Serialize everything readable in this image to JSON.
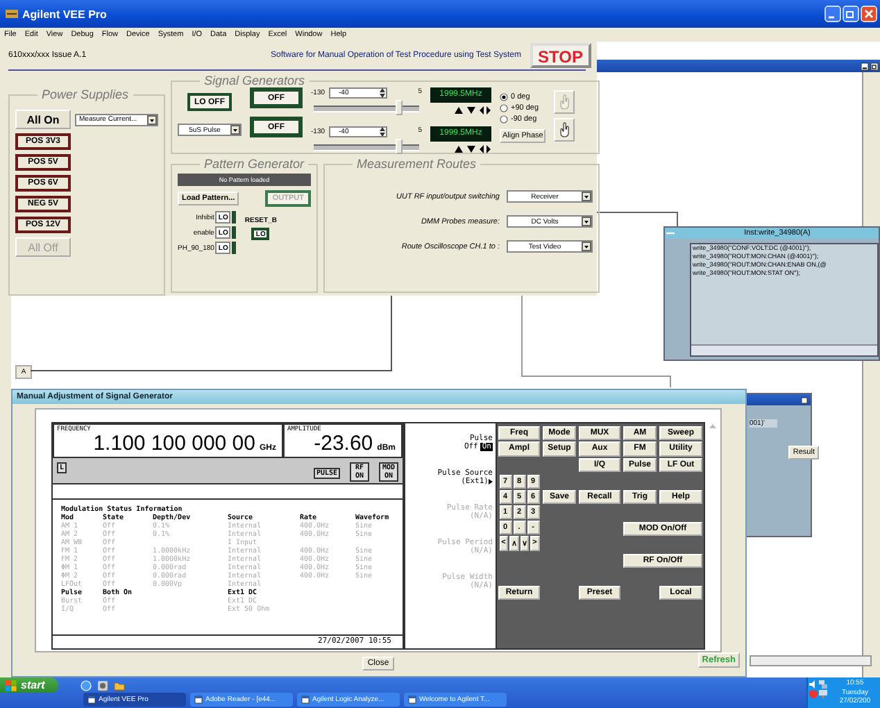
{
  "app": {
    "title": "Agilent VEE Pro",
    "menu": [
      "File",
      "Edit",
      "View",
      "Debug",
      "Flow",
      "Device",
      "System",
      "I/O",
      "Data",
      "Display",
      "Excel",
      "Window",
      "Help"
    ]
  },
  "panel": {
    "issue": "610xxx/xxx Issue A.1",
    "heading": "Software for Manual Operation of Test Procedure using Test System",
    "stop": "STOP",
    "power_supplies": {
      "title": "Power Supplies",
      "all_on": "All On",
      "measure": "Measure Current...",
      "rails": [
        "POS 3V3",
        "POS 5V",
        "POS 6V",
        "NEG 5V",
        "POS 12V"
      ],
      "all_off": {
        "label": "All Off",
        "disabled": true
      }
    },
    "signal_generators": {
      "title": "Signal Generators",
      "lo_off": "LO OFF",
      "pulse_mode": "5uS Pulse",
      "channels": [
        {
          "output": "OFF",
          "min": "-130",
          "value": "-40",
          "max": "5",
          "level": 0.8,
          "frequency": "1999.5MHz"
        },
        {
          "output": "OFF",
          "min": "-130",
          "value": "-40",
          "max": "5",
          "level": 0.8,
          "frequency": "1999.5MHz"
        }
      ],
      "phases": [
        {
          "label": "0 deg",
          "selected": true
        },
        {
          "label": "+90 deg",
          "selected": false
        },
        {
          "label": "-90 deg",
          "selected": false
        }
      ],
      "align_phase": "Align Phase",
      "hand_buttons": [
        {
          "disabled": true
        },
        {
          "disabled": false
        }
      ]
    },
    "pattern_generator": {
      "title": "Pattern Generator",
      "status": "No Pattern loaded",
      "load": "Load Pattern...",
      "output": {
        "label": "OUTPUT",
        "disabled": true
      },
      "lines": [
        {
          "label": "Inhibit",
          "value": "LO"
        },
        {
          "label": "enable",
          "value": "LO"
        },
        {
          "label": "PH_90_180",
          "value": "LO"
        }
      ],
      "reset": {
        "label": "RESET_B",
        "value": "LO"
      }
    },
    "measurement_routes": {
      "title": "Measurement Routes",
      "routes": [
        {
          "label": "UUT RF input/output switching",
          "value": "Receiver"
        },
        {
          "label": "DMM Probes measure:",
          "value": "DC Volts"
        },
        {
          "label": "Route Oscilloscope CH.1 to :",
          "value": "Test Video"
        }
      ]
    }
  },
  "workspace": {
    "tab": "A",
    "inst_box": {
      "title": "Inst:write_34980(A)",
      "lines": [
        "write_34980(\"CONF:VOLT:DC (@4001)\");",
        "write_34980(\"ROUT:MON:CHAN (@4001)\");",
        "write_34980(\"ROUT:MON:CHAN:ENAB ON,(@",
        "write_34980(\"ROUT:MON:STAT ON\");"
      ]
    },
    "back_window": {
      "text": "001)'",
      "button": "Result"
    }
  },
  "signal_window": {
    "title": "Manual Adjustment of Signal Generator",
    "frequency_label": "FREQUENCY",
    "frequency": "1.100 100 000 00",
    "frequency_unit": "GHz",
    "amplitude_label": "AMPLITUDE",
    "amplitude": "-23.60",
    "amplitude_unit": "dBm",
    "flags": {
      "local": "L",
      "pulse": "PULSE",
      "rf": "RF ON",
      "mod": "MOD ON"
    },
    "modulation": {
      "title": "Modulation Status Information",
      "columns": [
        "Mod",
        "State",
        "Depth/Dev",
        "Source",
        "Rate",
        "Waveform"
      ],
      "rows": [
        {
          "mod": "AM 1",
          "state": "Off",
          "depth": "0.1%",
          "source": "Internal",
          "rate": "400.0Hz",
          "waveform": "Sine",
          "active": false
        },
        {
          "mod": "AM 2",
          "state": "Off",
          "depth": "0.1%",
          "source": "Internal",
          "rate": "400.0Hz",
          "waveform": "Sine",
          "active": false
        },
        {
          "mod": "AM WB",
          "state": "Off",
          "source": "I Input",
          "active": false
        },
        {
          "mod": "FM 1",
          "state": "Off",
          "depth": "1.0000kHz",
          "source": "Internal",
          "rate": "400.0Hz",
          "waveform": "Sine",
          "active": false
        },
        {
          "mod": "FM 2",
          "state": "Off",
          "depth": "1.0000kHz",
          "source": "Internal",
          "rate": "400.0Hz",
          "waveform": "Sine",
          "active": false
        },
        {
          "mod": "ΦM 1",
          "state": "Off",
          "depth": "0.000rad",
          "source": "Internal",
          "rate": "400.0Hz",
          "waveform": "Sine",
          "active": false
        },
        {
          "mod": "ΦM 2",
          "state": "Off",
          "depth": "0.000rad",
          "source": "Internal",
          "rate": "400.0Hz",
          "waveform": "Sine",
          "active": false
        },
        {
          "mod": "LFOut",
          "state": "Off",
          "depth": "0.000Vp",
          "source": "Internal",
          "active": false
        },
        {
          "mod": "Pulse",
          "state": "Both On",
          "source": "Ext1 DC",
          "active": true
        },
        {
          "mod": "Burst",
          "state": "Off",
          "source": "Ext1 DC",
          "active": false
        },
        {
          "mod": "I/Q",
          "state": "Off",
          "source": "Ext 50 Ohm",
          "active": false
        }
      ]
    },
    "timestamp": "27/02/2007 10:55",
    "softkeys": [
      {
        "kind": "toggle",
        "label": "Pulse",
        "options": [
          {
            "label": "Off",
            "selected": false
          },
          {
            "label": "On",
            "selected": true
          }
        ]
      },
      {
        "kind": "menu",
        "label": "Pulse Source",
        "value": "(Ext1)",
        "disabled": false
      },
      {
        "kind": "menu",
        "label": "Pulse Rate",
        "value": "(N/A)",
        "disabled": true
      },
      {
        "kind": "menu",
        "label": "Pulse Period",
        "value": "(N/A)",
        "disabled": true
      },
      {
        "kind": "menu",
        "label": "Pulse Width",
        "value": "(N/A)",
        "disabled": true
      }
    ],
    "mode_keys": [
      [
        "Freq",
        "Mode",
        "MUX",
        "AM",
        "Sweep"
      ],
      [
        "Ampl",
        "Setup",
        "Aux",
        "FM",
        "Utility"
      ],
      [
        "I/Q",
        "Pulse",
        "LF Out"
      ]
    ],
    "keypad": [
      "7",
      "8",
      "9",
      "4",
      "5",
      "6",
      "1",
      "2",
      "3",
      "0",
      ".",
      "-",
      "<",
      "∧",
      "∨",
      ">"
    ],
    "function_keys": [
      "Save",
      "Recall",
      "Trig",
      "Help"
    ],
    "mod_key": "MOD On/Off",
    "rf_key": "RF On/Off",
    "return_key": "Return",
    "preset_key": "Preset",
    "local_key": "Local",
    "close": "Close",
    "refresh": "Refresh"
  },
  "taskbar": {
    "start": "start",
    "tasks": [
      {
        "label": "Agilent VEE Pro",
        "selected": true
      },
      {
        "label": "Adobe Reader - [e44...",
        "selected": false
      },
      {
        "label": "Agilent Logic Analyze...",
        "selected": false
      },
      {
        "label": "Welcome to Agilent T...",
        "selected": false
      }
    ],
    "clock": {
      "time": "10:55",
      "day": "Tuesday",
      "date": "27/02/200"
    }
  }
}
